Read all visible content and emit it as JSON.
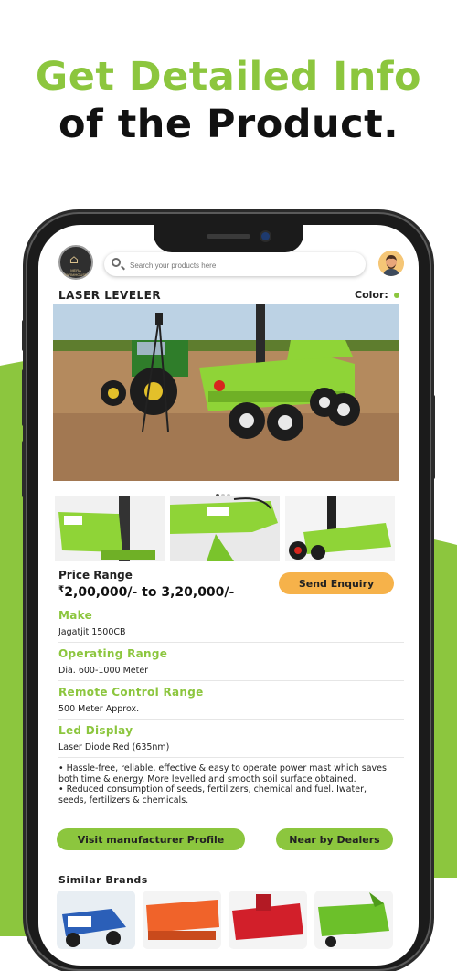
{
  "promo": {
    "headline_line1": "Get Detailed Info",
    "headline_line2": "of the Product.",
    "accent_color": "#8cc63e"
  },
  "app": {
    "logo_text": "MERA FARMHOUSE",
    "search_placeholder": "Search your products here",
    "product_title": "LASER LEVELER",
    "color_label": "Color:",
    "color_value": "#8cc63e",
    "carousel": {
      "count": 3,
      "active": 0
    },
    "price_label": "Price Range",
    "currency_symbol": "₹",
    "price_value": "2,00,000/- to 3,20,000/-",
    "send_enquiry_label": "Send Enquiry",
    "specs": [
      {
        "label": "Make",
        "value": "Jagatjit 1500CB"
      },
      {
        "label": "Operating Range",
        "value": "Dia. 600-1000 Meter"
      },
      {
        "label": "Remote Control Range",
        "value": "500 Meter Approx."
      },
      {
        "label": "Led Display",
        "value": "Laser Diode Red (635nm)"
      }
    ],
    "bullets": [
      "• Hassle-free, reliable, effective & easy to operate power mast which saves both time & energy. More levelled and smooth soil surface obtained.",
      "• Reduced consumption of seeds, fertilizers, chemical and fuel. Iwater, seeds, fertilizers & chemicals."
    ],
    "visit_manufacturer_label": "Visit manufacturer Profile",
    "near_dealers_label": "Near by Dealers",
    "similar_brands_label": "Similar Brands",
    "similar_brands_icons": [
      "blue-harvester-image",
      "orange-seed-drill-image",
      "red-rotavator-image",
      "green-thresher-image"
    ]
  }
}
